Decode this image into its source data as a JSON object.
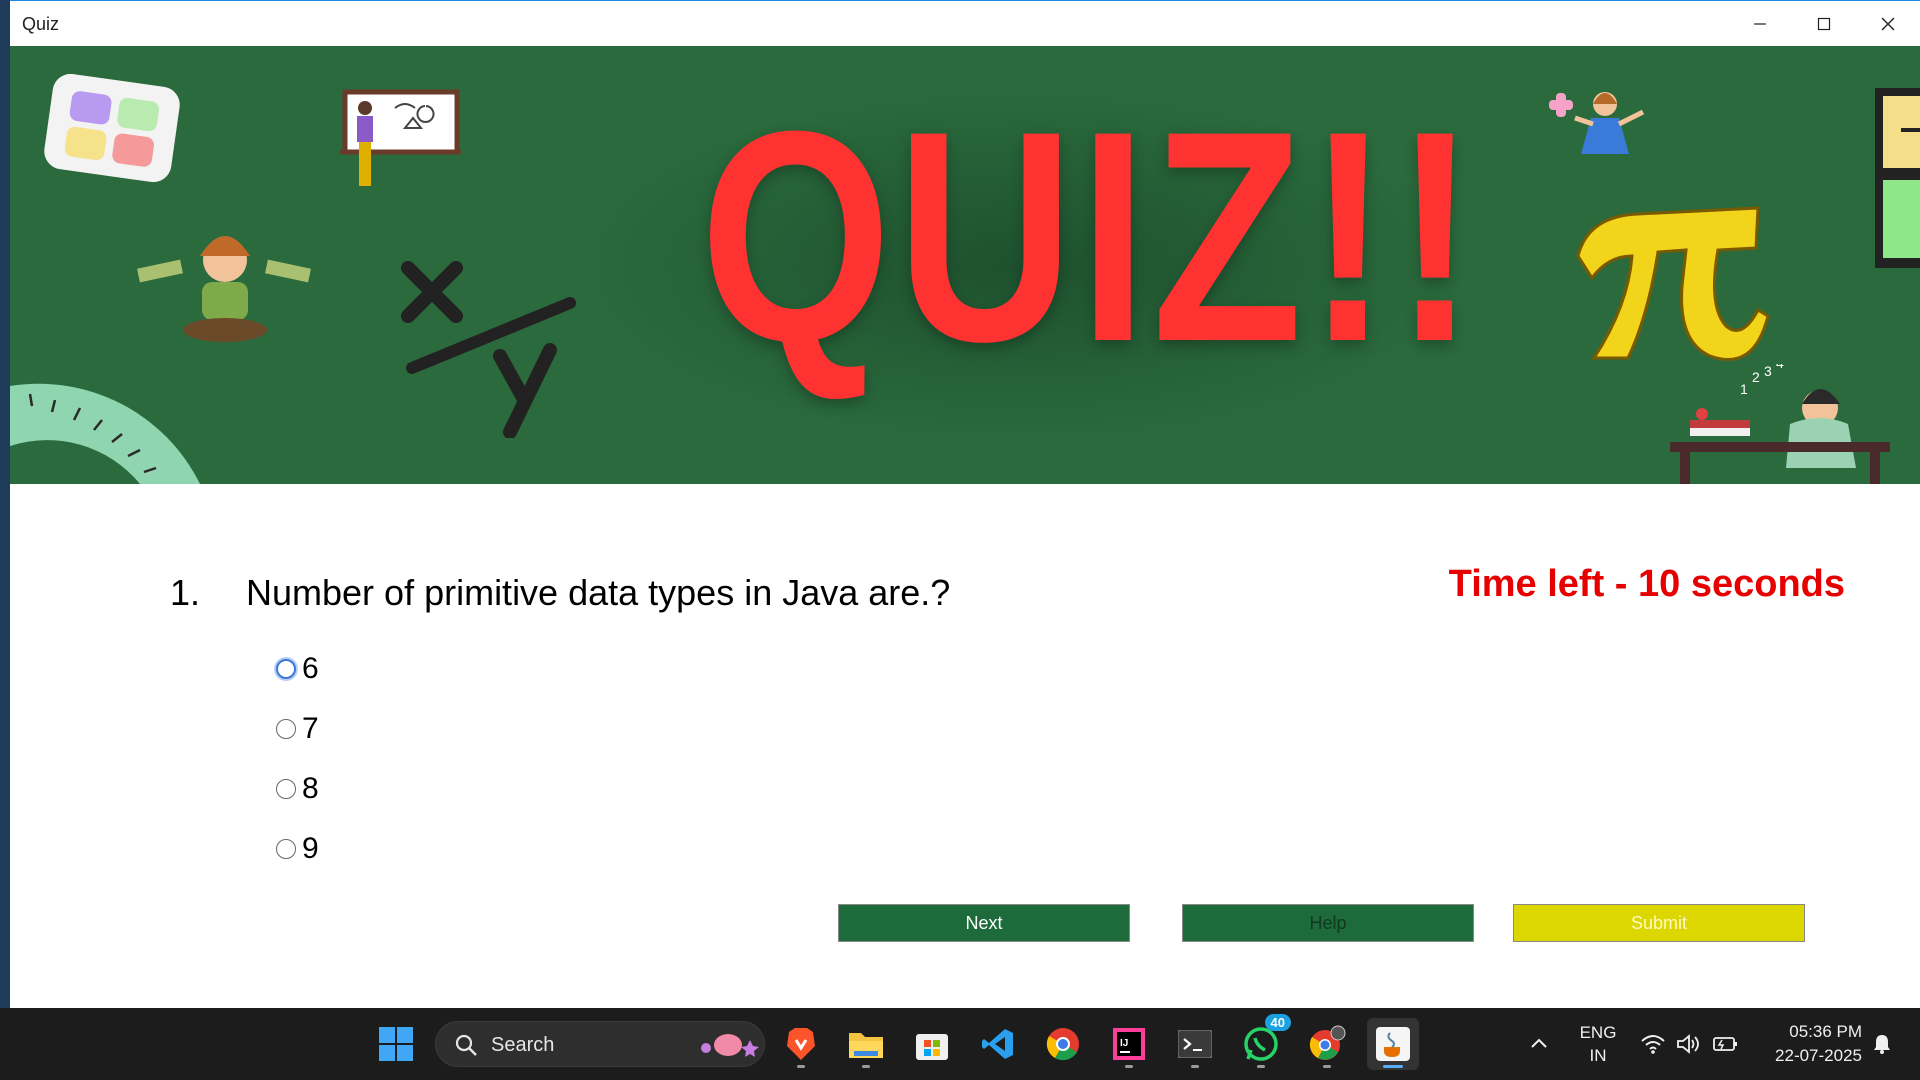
{
  "window": {
    "title": "Quiz"
  },
  "banner": {
    "headline": "QUIZ!!"
  },
  "question": {
    "number": "1.",
    "text": "Number of primitive data types in Java are.?",
    "timer": "Time left - 10 seconds",
    "options": [
      {
        "label": "6"
      },
      {
        "label": "7"
      },
      {
        "label": "8"
      },
      {
        "label": "9"
      }
    ]
  },
  "buttons": {
    "next": "Next",
    "help": "Help",
    "submit": "Submit"
  },
  "taskbar": {
    "search_label": "Search",
    "apps": [
      "windows-start",
      "brave-browser",
      "file-explorer",
      "microsoft-store",
      "vscode",
      "chrome",
      "intellij",
      "terminal",
      "whatsapp",
      "chrome-profile",
      "java-app"
    ],
    "whatsapp_badge": "40",
    "lang_top": "ENG",
    "lang_bottom": "IN",
    "time": "05:36 PM",
    "date": "22-07-2025"
  },
  "colors": {
    "banner_bg": "#2a6a3c",
    "quiz_red": "#ff3232",
    "timer_red": "#e60000",
    "button_green": "#1d6b3a",
    "submit_yellow": "#dcd700"
  }
}
